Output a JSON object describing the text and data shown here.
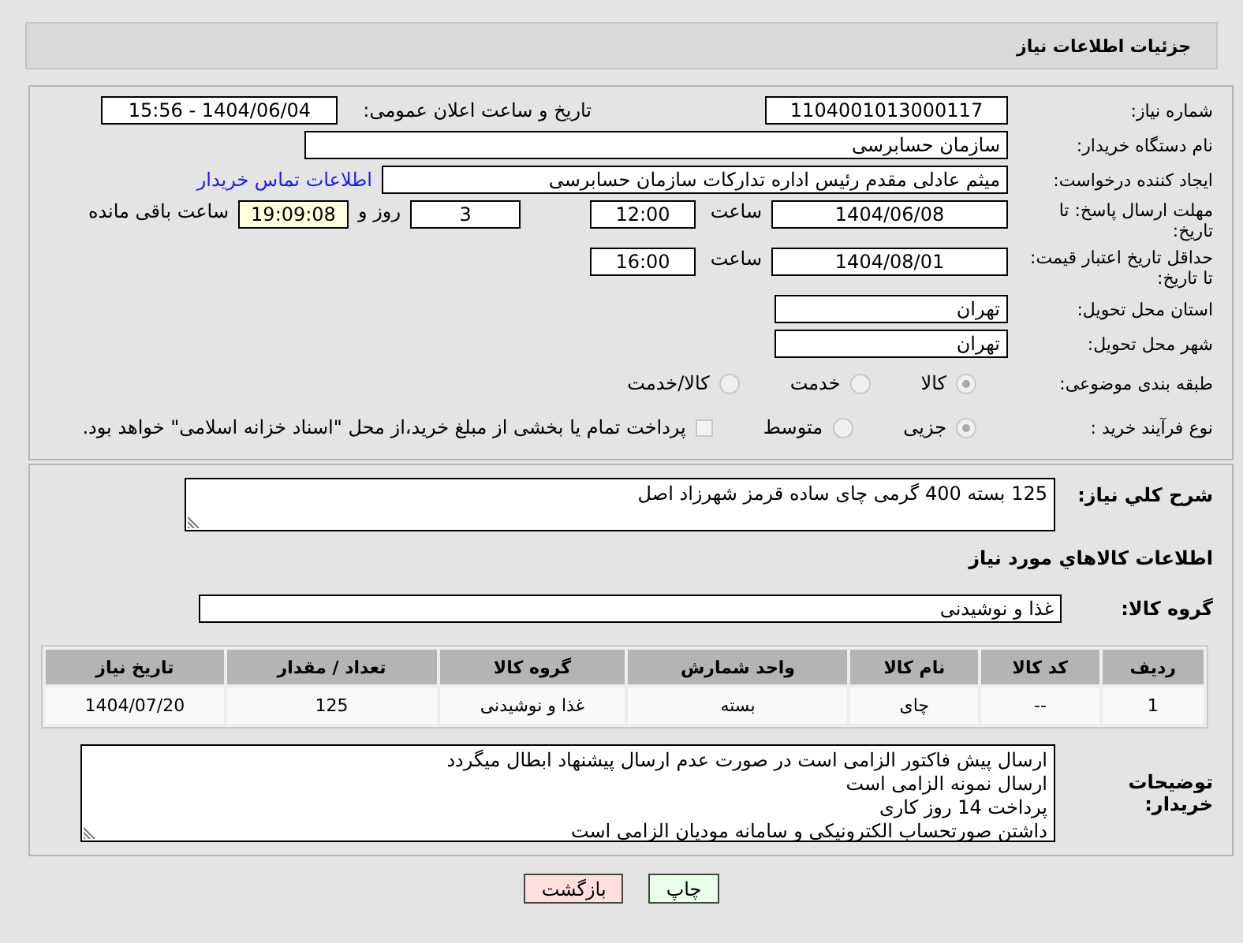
{
  "header": {
    "title": "جزئیات اطلاعات نیاز"
  },
  "need_number": {
    "label": "شماره نیاز:",
    "value": "1104001013000117"
  },
  "announce": {
    "label": "تاریخ و ساعت اعلان عمومی:",
    "value": "1404/06/04 - 15:56"
  },
  "buyer_org": {
    "label": "نام دستگاه خریدار:",
    "value": "سازمان حسابرسی"
  },
  "requester": {
    "label": "ایجاد کننده درخواست:",
    "value": "میثم عادلی مقدم رئیس اداره تدارکات سازمان حسابرسی",
    "link": "اطلاعات تماس خریدار"
  },
  "reply_deadline": {
    "label": "مهلت ارسال پاسخ: تا تاریخ:",
    "date": "1404/06/08",
    "time_label": "ساعت",
    "time": "12:00",
    "days": "3",
    "days_label": "روز و",
    "remaining": "19:09:08",
    "remaining_label": "ساعت باقی مانده"
  },
  "price_validity": {
    "label": "حداقل تاریخ اعتبار قیمت: تا تاریخ:",
    "date": "1404/08/01",
    "time_label": "ساعت",
    "time": "16:00"
  },
  "province": {
    "label": "استان محل تحویل:",
    "value": "تهران"
  },
  "city": {
    "label": "شهر محل تحویل:",
    "value": "تهران"
  },
  "category": {
    "label": "طبقه بندی موضوعی:",
    "options": [
      {
        "label": "کالا",
        "selected": true
      },
      {
        "label": "خدمت",
        "selected": false
      },
      {
        "label": "کالا/خدمت",
        "selected": false
      }
    ]
  },
  "process": {
    "label": "نوع فرآیند خرید :",
    "options": [
      {
        "label": "جزیی",
        "selected": true
      },
      {
        "label": "متوسط",
        "selected": false
      }
    ],
    "payment": {
      "checked": false,
      "label": "پرداخت تمام یا بخشی از مبلغ خرید،از محل \"اسناد خزانه اسلامی\" خواهد بود."
    }
  },
  "description": {
    "label": "شرح کلي نياز:",
    "value": "125 بسته 400 گرمی چای ساده قرمز شهرزاد اصل"
  },
  "goods_heading": "اطلاعات کالاهاي مورد نياز",
  "goods_group": {
    "label": "گروه کالا:",
    "value": "غذا و نوشیدنی"
  },
  "table": {
    "columns": [
      "ردیف",
      "کد کالا",
      "نام کالا",
      "واحد شمارش",
      "گروه کالا",
      "تعداد / مقدار",
      "تاریخ نیاز"
    ],
    "rows": [
      [
        "1",
        "--",
        "چای",
        "بسته",
        "غذا و نوشیدنی",
        "125",
        "1404/07/20"
      ]
    ]
  },
  "buyer_notes": {
    "label": "توضیحات خریدار:",
    "lines": [
      "ارسال پیش فاکتور الزامی است در صورت عدم ارسال پیشنهاد ابطال میگردد",
      "ارسال نمونه الزامی است",
      "پرداخت 14 روز کاری",
      "داشتن صورتحساب الکترونیکی و سامانه مودیان الزامی است"
    ]
  },
  "buttons": [
    {
      "label": "چاپ",
      "kind": "print"
    },
    {
      "label": "بازگشت",
      "kind": "back"
    }
  ]
}
